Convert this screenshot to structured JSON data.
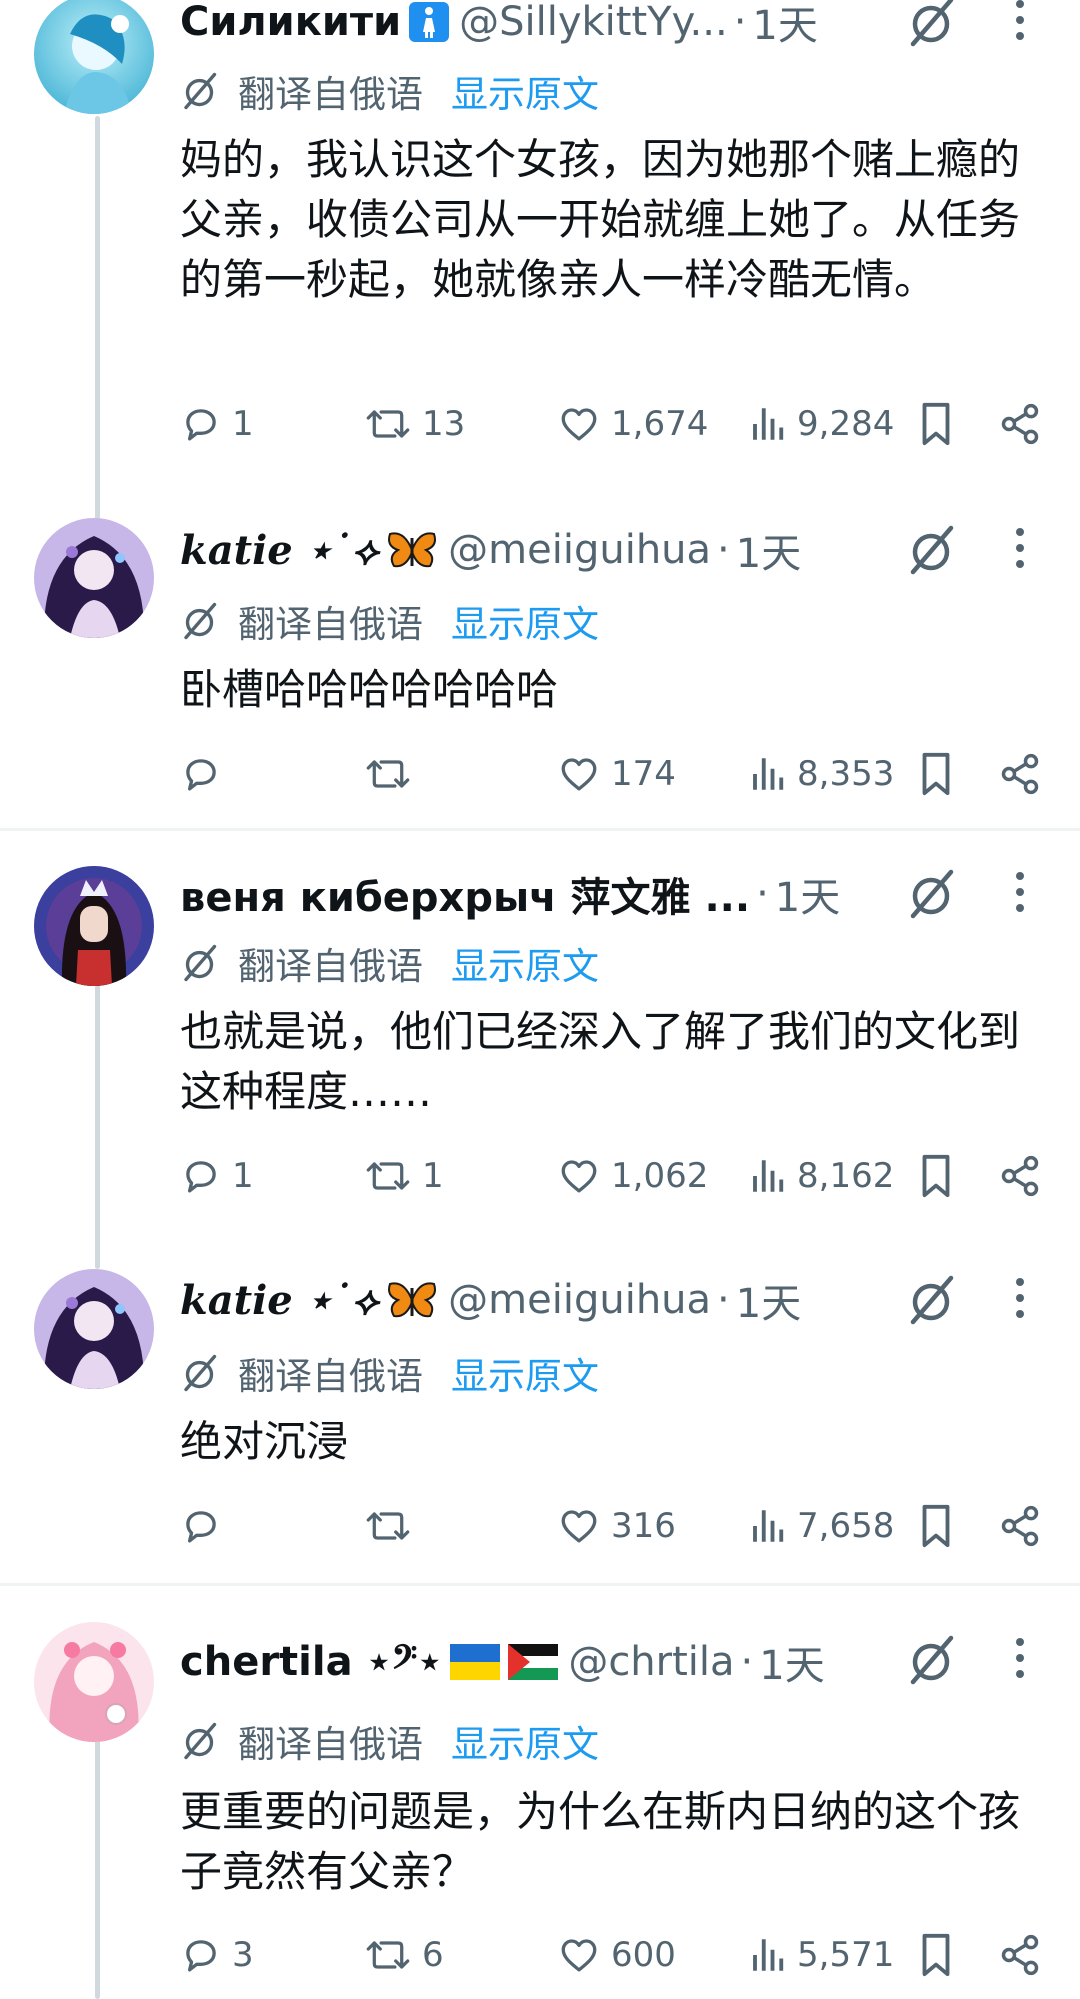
{
  "translate_label": "翻译自俄语",
  "show_original_label": "显示原文",
  "tweets": [
    {
      "display_name": "Силикити",
      "handle": "@SillykittYy...",
      "separator": "·",
      "time": "1天",
      "text": "妈的，我认识这个女孩，因为她那个赌上瘾的父亲，收债公司从一开始就缠上她了。从任务的第一秒起，她就像亲人一样冷酷无情。",
      "replies": "1",
      "retweets": "13",
      "likes": "1,674",
      "views": "9,284"
    },
    {
      "display_name": "katie ⋆˙⟡",
      "handle": "@meiiguihua",
      "separator": "·",
      "time": "1天",
      "text": "卧槽哈哈哈哈哈哈哈",
      "replies": "",
      "retweets": "",
      "likes": "174",
      "views": "8,353"
    },
    {
      "display_name": "веня киберхрыч 萍文雅 ...",
      "handle": "",
      "separator": "·",
      "time": "1天",
      "text": "也就是说，他们已经深入了解了我们的文化到这种程度……",
      "replies": "1",
      "retweets": "1",
      "likes": "1,062",
      "views": "8,162"
    },
    {
      "display_name": "katie ⋆˙⟡",
      "handle": "@meiiguihua",
      "separator": "·",
      "time": "1天",
      "text": "绝对沉浸",
      "replies": "",
      "retweets": "",
      "likes": "316",
      "views": "7,658"
    },
    {
      "display_name": "chertila ⋆𝄢⋆",
      "handle": "@chrtila",
      "separator": "·",
      "time": "1天",
      "text": "更重要的问题是，为什么在斯内日纳的这个孩子竟然有父亲？",
      "replies": "3",
      "retweets": "6",
      "likes": "600",
      "views": "5,571"
    }
  ],
  "colors": {
    "text_primary": "#0f1419",
    "text_secondary": "#536471",
    "link": "#1d9bf0",
    "thread_line": "#cfd9de",
    "separator": "#eff3f4"
  },
  "icons": [
    "grok-icon",
    "more-icon",
    "translate-icon",
    "reply-icon",
    "retweet-icon",
    "like-icon",
    "views-icon",
    "bookmark-icon",
    "share-icon",
    "restroom-icon",
    "butterfly-icon",
    "ukraine-flag-icon",
    "palestine-flag-icon"
  ]
}
